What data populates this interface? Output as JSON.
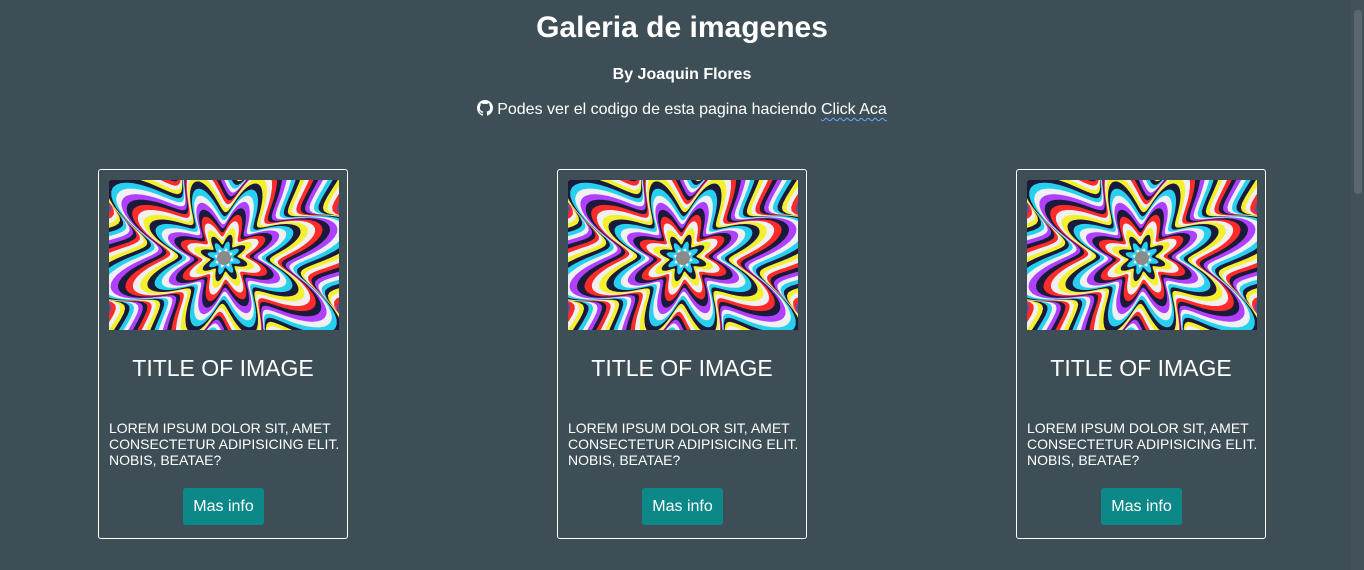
{
  "header": {
    "title": "Galeria de imagenes",
    "author": "By Joaquin Flores",
    "source_text": "Podes ver el codigo de esta pagina haciendo",
    "source_link": "Click Aca",
    "source_icon": "github-icon"
  },
  "cards": [
    {
      "image": "psychedelic-flower-image",
      "title": "Title of image",
      "text": "Lorem ipsum dolor sit, amet consectetur adipisicing elit. Nobis, beatae?",
      "button": "Mas info"
    },
    {
      "image": "psychedelic-flower-image",
      "title": "Title of image",
      "text": "Lorem ipsum dolor sit, amet consectetur adipisicing elit. Nobis, beatae?",
      "button": "Mas info"
    },
    {
      "image": "psychedelic-flower-image",
      "title": "Title of image",
      "text": "Lorem ipsum dolor sit, amet consectetur adipisicing elit. Nobis, beatae?",
      "button": "Mas info"
    }
  ],
  "colors": {
    "background": "#3e4e56",
    "button": "#0d8888",
    "text": "#ffffff"
  }
}
